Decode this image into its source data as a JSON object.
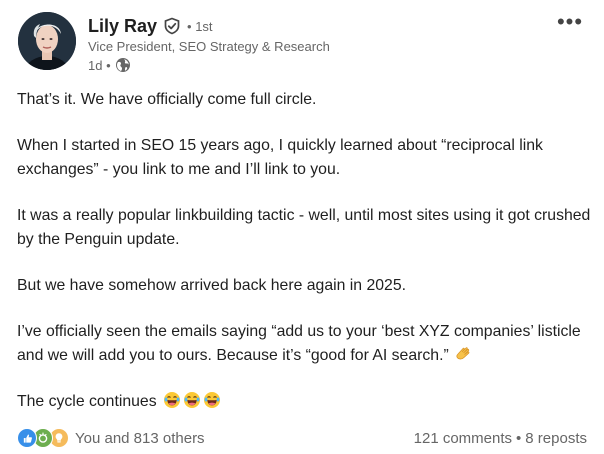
{
  "post": {
    "author": {
      "name": "Lily Ray",
      "degree": "• 1st",
      "headline": "Vice President, SEO Strategy & Research",
      "time": "1d •"
    },
    "more_label": "•••",
    "paragraphs": [
      "That’s it. We have officially come full circle.",
      "When I started in SEO 15 years ago, I quickly learned about “reciprocal link exchanges” - you link to me and I’ll link to you.",
      "It was a really popular linkbuilding tactic - well, until most sites using it got crushed by the Penguin update.",
      "But we have somehow arrived back here again in 2025.",
      "I’ve officially seen the emails saying “add us to your ‘best XYZ companies’ listicle and we will add you to ours. Because it’s “good for AI search.”"
    ],
    "closing": "The cycle continues",
    "reactions_text": "You and 813 others",
    "comments_text": "121 comments",
    "separator": "•",
    "reposts_text": "8 reposts"
  },
  "colors": {
    "text": "#1f1f1f",
    "muted": "#666666",
    "like_blue": "#378fe9",
    "celebrate_green": "#44712e",
    "insightful_yellow": "#f5bb5c"
  },
  "icons": [
    "verified-shield-icon",
    "globe-icon",
    "more-options-icon",
    "clap-emoji-icon",
    "laughing-emoji-icon",
    "like-reaction-icon",
    "celebrate-reaction-icon",
    "insightful-reaction-icon"
  ]
}
